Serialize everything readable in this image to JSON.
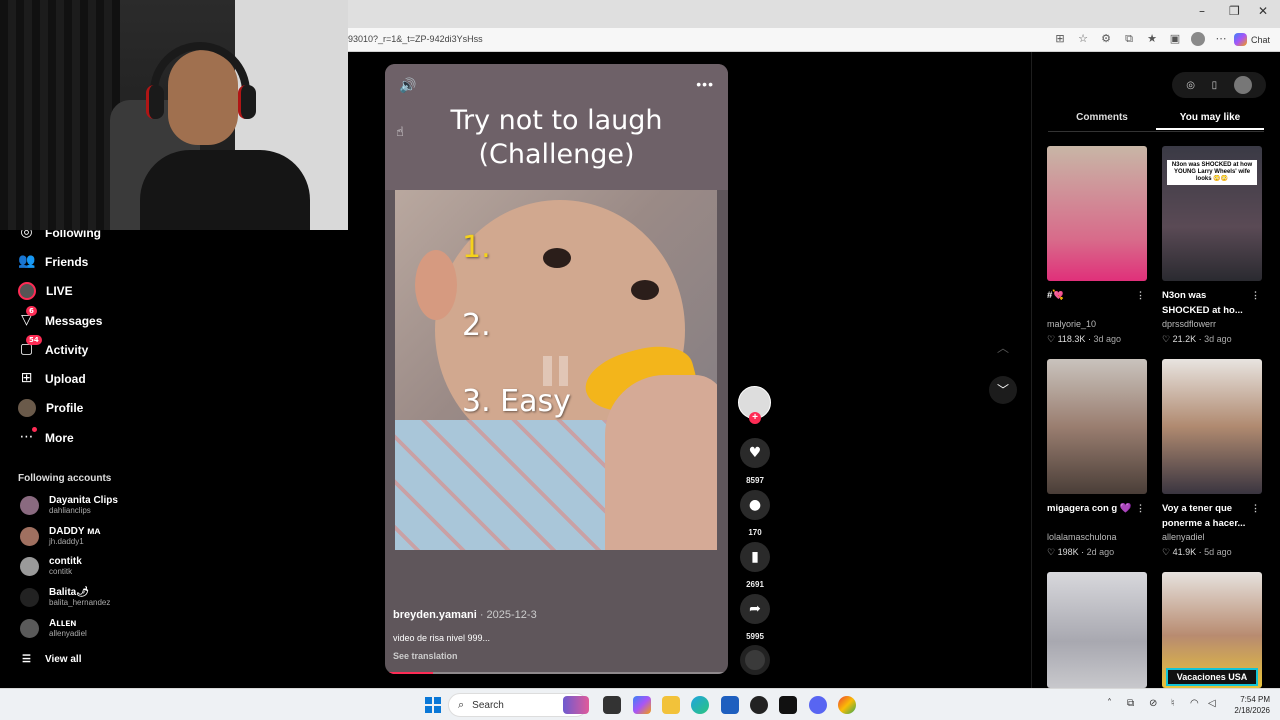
{
  "browser": {
    "url": "93010?_r=1&_t=ZP-942di3YsHss",
    "copilot_label": "Chat",
    "window_controls": [
      "–",
      "❐",
      "✕"
    ]
  },
  "sidebar": {
    "items": [
      {
        "label": "Following",
        "icon": "following-icon"
      },
      {
        "label": "Friends",
        "icon": "friends-icon"
      },
      {
        "label": "LIVE",
        "icon": "live-icon"
      },
      {
        "label": "Messages",
        "icon": "messages-icon",
        "badge": "6"
      },
      {
        "label": "Activity",
        "icon": "activity-icon",
        "badge": "54"
      },
      {
        "label": "Upload",
        "icon": "upload-icon"
      },
      {
        "label": "Profile",
        "icon": "profile-avatar"
      },
      {
        "label": "More",
        "icon": "more-icon"
      }
    ],
    "following_title": "Following accounts",
    "accounts": [
      {
        "name": "Dayanita Clips",
        "handle": "dahlianclips"
      },
      {
        "name": "DADDY ᴍᴀ",
        "handle": "jh.daddy1"
      },
      {
        "name": "contitk",
        "handle": "contitk"
      },
      {
        "name": "Balita🌶",
        "handle": "balita_hernandez"
      },
      {
        "name": "Aʟʟᴇɴ",
        "handle": "allenyadiel"
      }
    ],
    "view_all": "View all"
  },
  "video": {
    "title_line1": "Try not to laugh",
    "title_line2": "(Challenge)",
    "num1": "1.",
    "num2": "2.",
    "num3": "3. Easy",
    "author": "breyden.yamani",
    "date": " · 2025-12-3",
    "caption": "video de risa nivel 999...",
    "translate": "See translation",
    "progress": 0.14
  },
  "actions": {
    "likes": "8597",
    "comments": "170",
    "saves": "2691",
    "shares": "5995"
  },
  "right_panel": {
    "tabs": [
      "Comments",
      "You may like"
    ],
    "active_tab": 1,
    "cards": [
      {
        "title": "#💘",
        "user": "malyorie_10",
        "likes": "118.3K",
        "ago": "3d ago"
      },
      {
        "title": "N3on was SHOCKED at ho...",
        "user": "dprssdflowerr",
        "likes": "21.2K",
        "ago": "3d ago",
        "thumb_caption": "N3on was SHOCKED at how YOUNG Larry Wheels' wife looks 😳😳"
      },
      {
        "title": "migagera con g 💜",
        "user": "lolalamaschulona",
        "likes": "198K",
        "ago": "2d ago"
      },
      {
        "title": "Voy a tener que ponerme a hacer...",
        "user": "allenyadiel",
        "likes": "41.9K",
        "ago": "5d ago"
      },
      {
        "title": "",
        "user": "",
        "likes": "",
        "ago": ""
      },
      {
        "title": "",
        "user": "",
        "likes": "",
        "ago": "",
        "thumb_label": "Vacaciones USA"
      }
    ]
  },
  "taskbar": {
    "search": "Search",
    "time": "7:54 PM",
    "date": "2/18/2026"
  }
}
